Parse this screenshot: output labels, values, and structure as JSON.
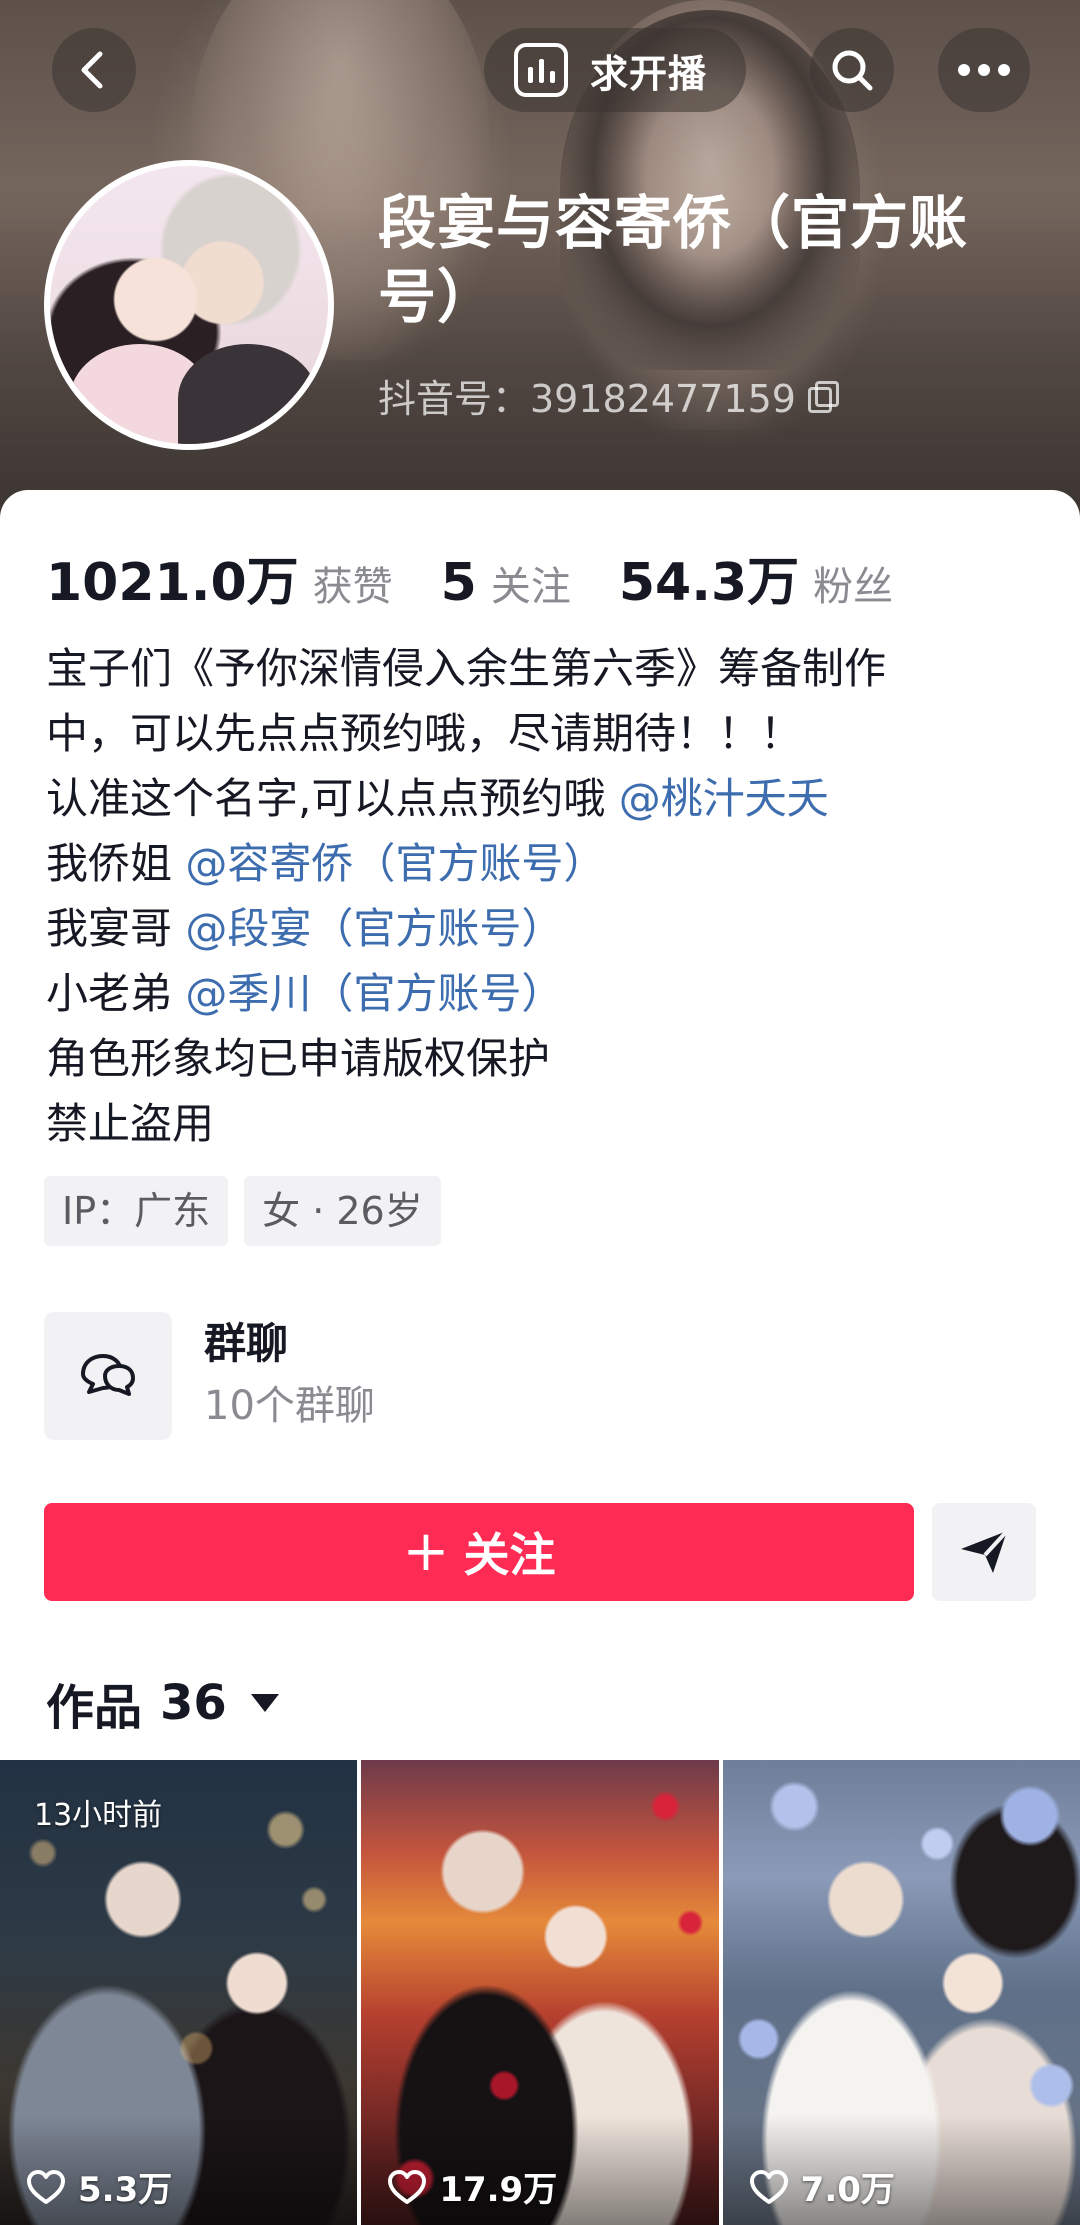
{
  "header": {
    "live_label": "求开播",
    "icons": {
      "back": "back-chevron-icon",
      "live": "live-stats-icon",
      "search": "search-icon",
      "more": "more-dots-icon"
    }
  },
  "profile": {
    "name": "段宴与容寄侨（官方账号）",
    "douyin_id": "抖音号：39182477159",
    "stats": [
      {
        "value": "1021.0万",
        "label": "获赞"
      },
      {
        "value": "5",
        "label": "关注"
      },
      {
        "value": "54.3万",
        "label": "粉丝"
      }
    ]
  },
  "bio": {
    "line1": "宝子们《予你深情侵入余生第六季》筹备制作",
    "line2": "中，可以先点点预约哦，尽请期待！！！",
    "line3_text": "认准这个名字,可以点点预约哦 ",
    "line3_mention": "@桃汁夭夭",
    "line4_text": "我侨姐 ",
    "line4_mention": "@容寄侨（官方账号）",
    "line5_text": "我宴哥 ",
    "line5_mention": "@段宴（官方账号）",
    "line6_text": "小老弟 ",
    "line6_mention": "@季川（官方账号）",
    "line7": "角色形象均已申请版权保护",
    "line8": "禁止盗用"
  },
  "tags": {
    "ip": "IP：广东",
    "gender_age": "女 · 26岁"
  },
  "group_chat": {
    "title": "群聊",
    "subtitle": "10个群聊"
  },
  "actions": {
    "follow_label": "关注",
    "follow_plus": "+"
  },
  "works": {
    "label": "作品",
    "count": "36"
  },
  "videos": [
    {
      "time": "13小时前",
      "likes": "5.3万"
    },
    {
      "likes": "17.9万"
    },
    {
      "likes": "7.0万"
    }
  ],
  "colors": {
    "accent": "#fe2c55",
    "mention": "#3d6dae",
    "muted": "#8a8b91"
  }
}
